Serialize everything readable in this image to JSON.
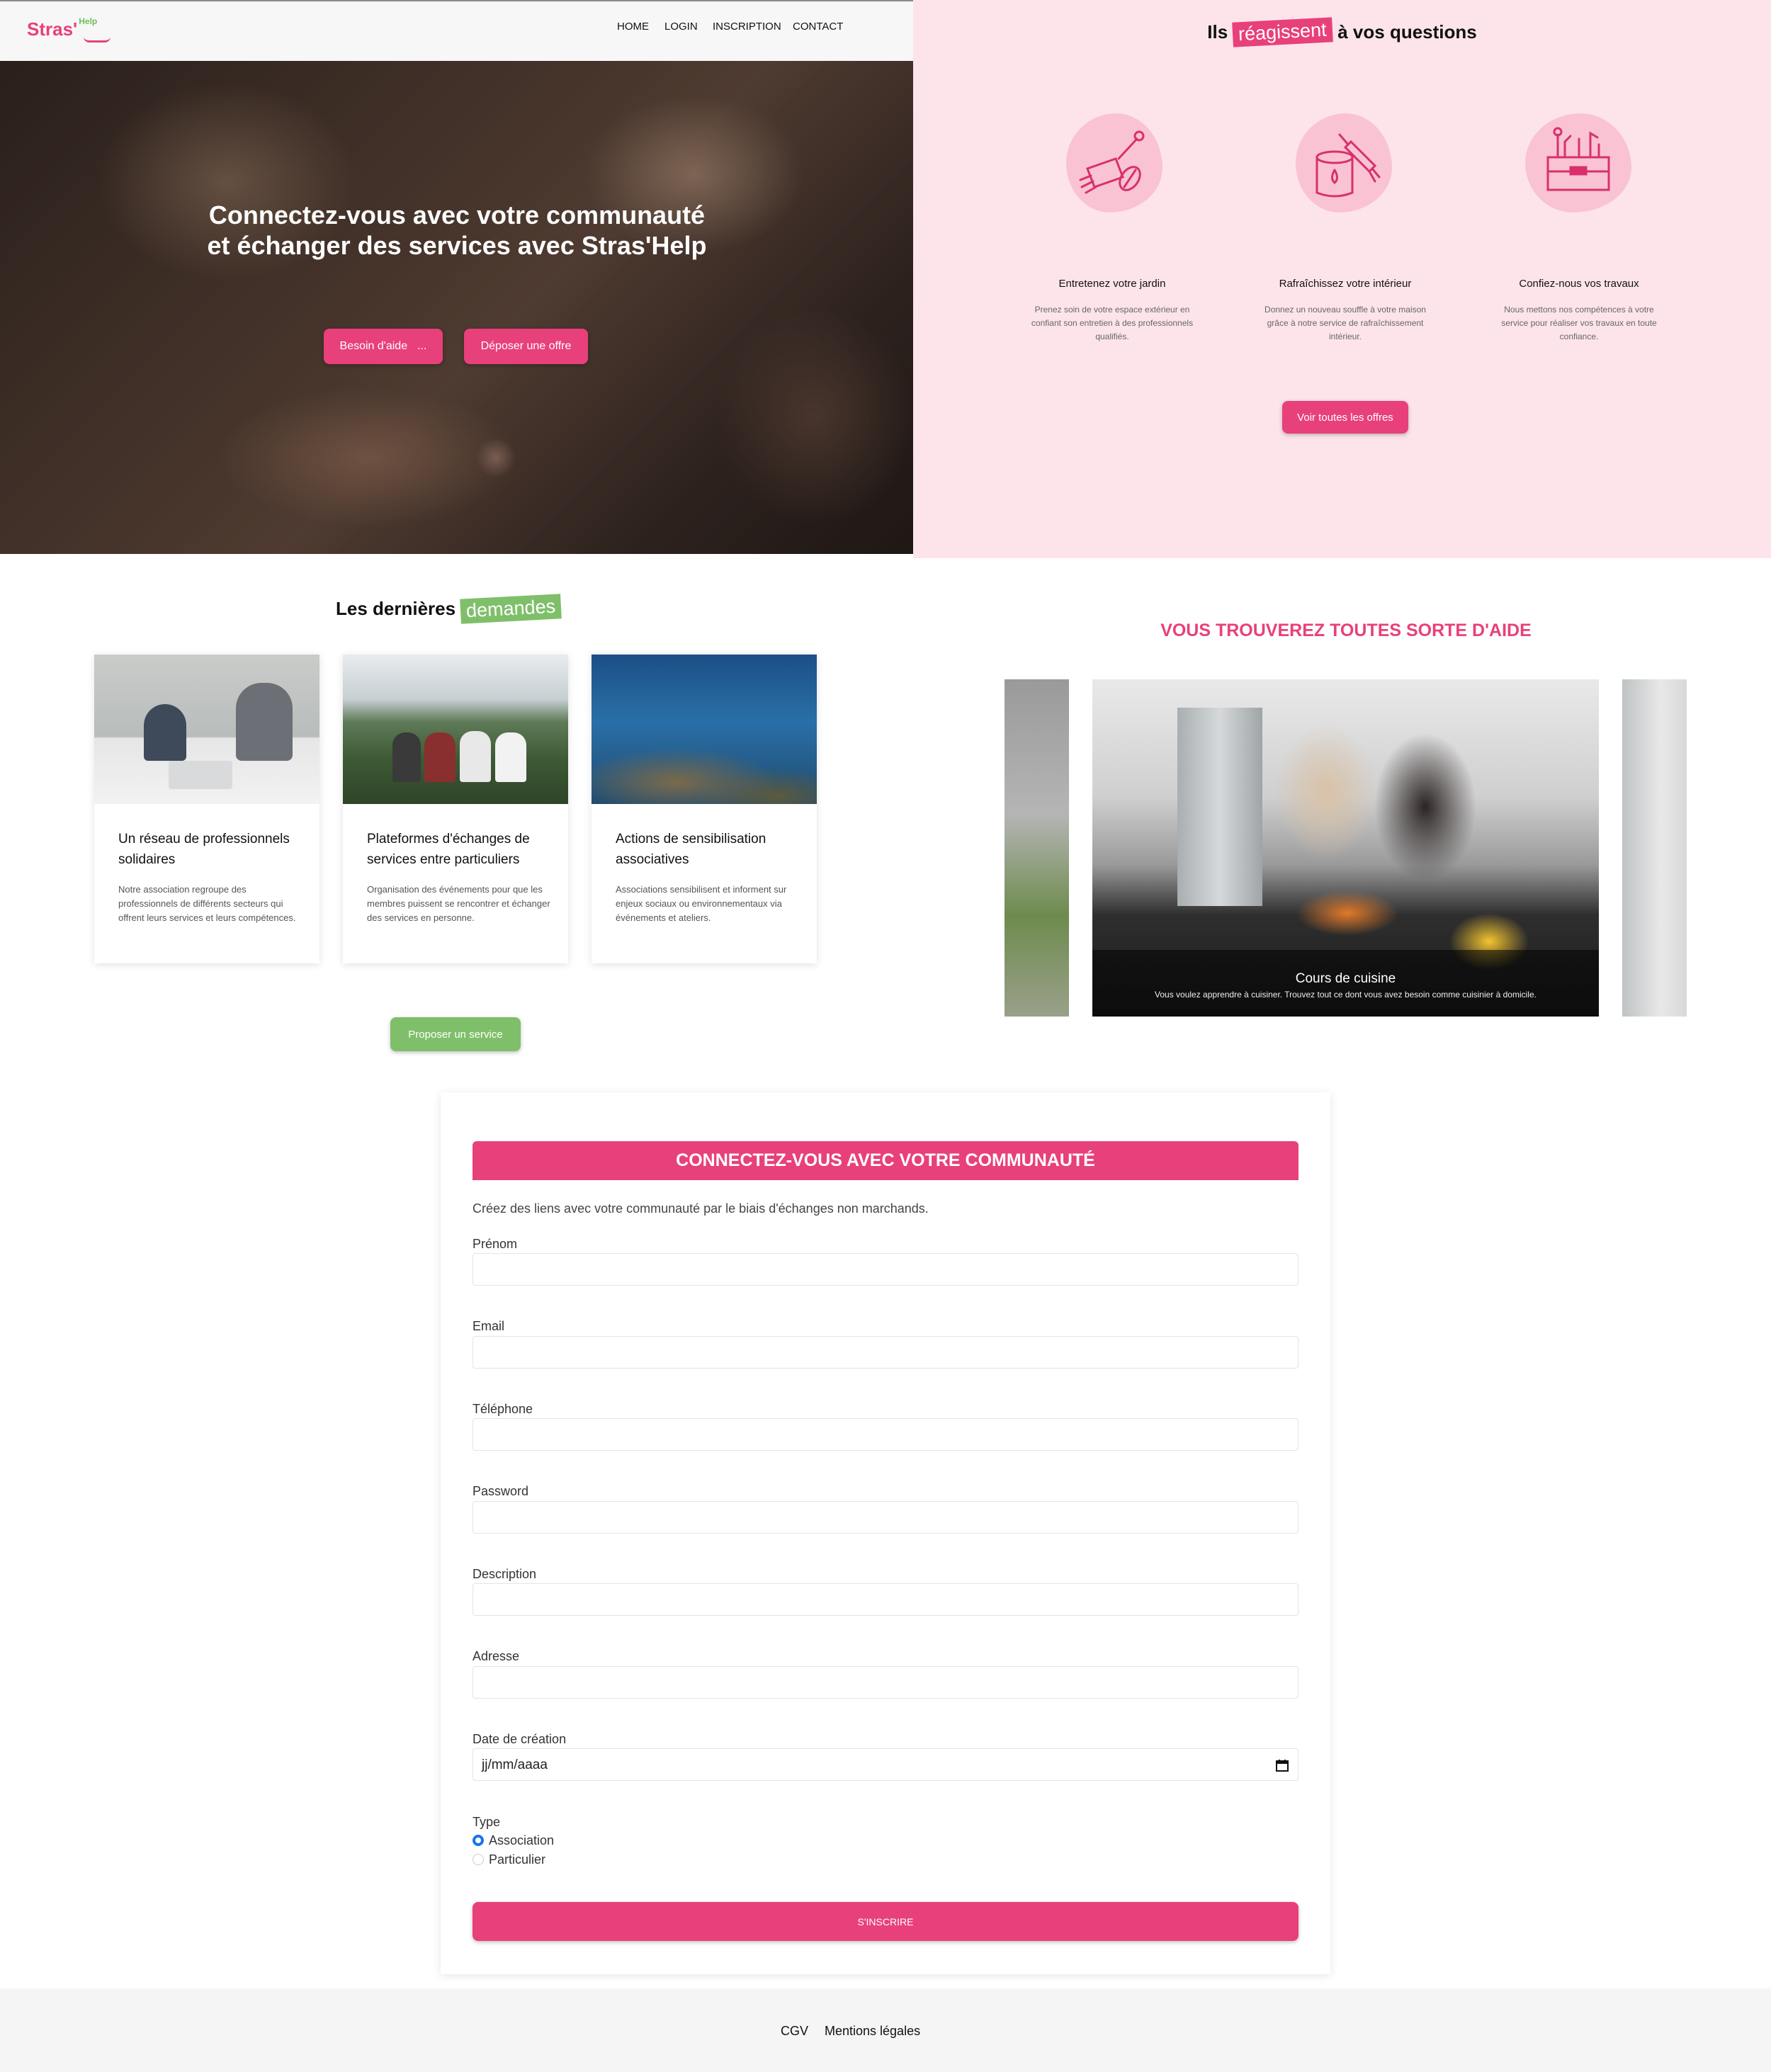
{
  "nav": {
    "logo_text": "Stras'",
    "logo_sup": "Help",
    "links": [
      "HOME",
      "LOGIN",
      "INSCRIPTION",
      "CONTACT"
    ]
  },
  "hero": {
    "title": "Connectez-vous avec votre communauté et échanger des services avec Stras'Help",
    "btn_help": "Besoin d'aide",
    "btn_help_dots": "...",
    "btn_offer": "Déposer une offre"
  },
  "services": {
    "heading_pre": "Ils",
    "heading_tag": "réagissent",
    "heading_post": "à vos questions",
    "items": [
      {
        "title": "Entretenez votre jardin",
        "text": "Prenez soin de votre espace extérieur en confiant son entretien à des professionnels qualifiés.",
        "icon": "garden-icon"
      },
      {
        "title": "Rafraîchissez votre intérieur",
        "text": "Donnez un nouveau souffle à votre maison grâce à notre service de rafraîchissement intérieur.",
        "icon": "paint-icon"
      },
      {
        "title": "Confiez-nous vos travaux",
        "text": "Nous mettons nos compétences à votre service pour réaliser vos travaux en toute confiance.",
        "icon": "toolbox-icon"
      }
    ],
    "btn_all": "Voir toutes les offres"
  },
  "requests": {
    "heading_pre": "Les dernières",
    "heading_tag": "demandes",
    "cards": [
      {
        "title": "Un réseau de professionnels solidaires",
        "text": "Notre association regroupe des professionnels de différents secteurs qui offrent leurs services et leurs compétences."
      },
      {
        "title": "Plateformes d'échanges de services entre particuliers",
        "text": "Organisation des événements pour que les membres puissent se rencontrer et échanger des services en personne."
      },
      {
        "title": "Actions de sensibilisation associatives",
        "text": "Associations sensibilisent et informent sur enjeux sociaux ou environnementaux via événements et ateliers."
      }
    ],
    "btn_propose": "Proposer un service"
  },
  "carousel": {
    "title": "VOUS TROUVEREZ TOUTES SORTE D'AIDE",
    "caption_title": "Cours de cuisine",
    "caption_text": "Vous voulez apprendre à cuisiner. Trouvez tout ce dont vous avez besoin comme cuisinier à domicile."
  },
  "form": {
    "header": "CONNECTEZ-VOUS AVEC VOTRE COMMUNAUTÉ",
    "intro": "Créez des liens avec votre communauté par le biais d'échanges non marchands.",
    "fields": [
      {
        "label": "Prénom",
        "value": ""
      },
      {
        "label": "Email",
        "value": ""
      },
      {
        "label": "Téléphone",
        "value": ""
      },
      {
        "label": "Password",
        "value": ""
      },
      {
        "label": "Description",
        "value": ""
      },
      {
        "label": "Adresse",
        "value": ""
      },
      {
        "label": "Date de création",
        "placeholder": "jj/mm/aaaa"
      }
    ],
    "type_label": "Type",
    "options": [
      {
        "label": "Association",
        "selected": true
      },
      {
        "label": "Particulier",
        "selected": false
      }
    ],
    "submit": "S'INSCRIRE"
  },
  "footer": {
    "links": [
      "CGV",
      "Mentions légales"
    ]
  },
  "colors": {
    "accent": "#e8407a",
    "green": "#7fbf6a",
    "pink_bg": "#fde4ea"
  }
}
